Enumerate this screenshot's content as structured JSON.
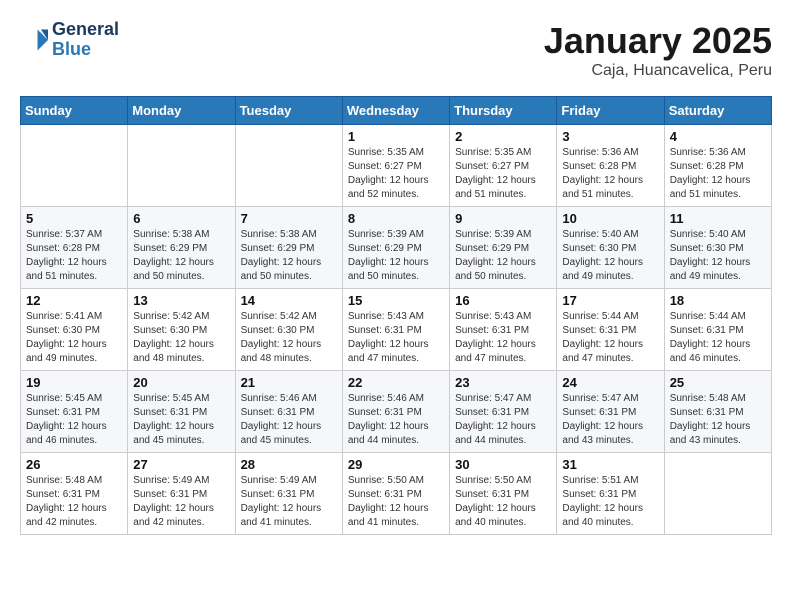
{
  "header": {
    "logo_line1": "General",
    "logo_line2": "Blue",
    "title": "January 2025",
    "subtitle": "Caja, Huancavelica, Peru"
  },
  "weekdays": [
    "Sunday",
    "Monday",
    "Tuesday",
    "Wednesday",
    "Thursday",
    "Friday",
    "Saturday"
  ],
  "weeks": [
    [
      {
        "day": "",
        "info": ""
      },
      {
        "day": "",
        "info": ""
      },
      {
        "day": "",
        "info": ""
      },
      {
        "day": "1",
        "info": "Sunrise: 5:35 AM\nSunset: 6:27 PM\nDaylight: 12 hours\nand 52 minutes."
      },
      {
        "day": "2",
        "info": "Sunrise: 5:35 AM\nSunset: 6:27 PM\nDaylight: 12 hours\nand 51 minutes."
      },
      {
        "day": "3",
        "info": "Sunrise: 5:36 AM\nSunset: 6:28 PM\nDaylight: 12 hours\nand 51 minutes."
      },
      {
        "day": "4",
        "info": "Sunrise: 5:36 AM\nSunset: 6:28 PM\nDaylight: 12 hours\nand 51 minutes."
      }
    ],
    [
      {
        "day": "5",
        "info": "Sunrise: 5:37 AM\nSunset: 6:28 PM\nDaylight: 12 hours\nand 51 minutes."
      },
      {
        "day": "6",
        "info": "Sunrise: 5:38 AM\nSunset: 6:29 PM\nDaylight: 12 hours\nand 50 minutes."
      },
      {
        "day": "7",
        "info": "Sunrise: 5:38 AM\nSunset: 6:29 PM\nDaylight: 12 hours\nand 50 minutes."
      },
      {
        "day": "8",
        "info": "Sunrise: 5:39 AM\nSunset: 6:29 PM\nDaylight: 12 hours\nand 50 minutes."
      },
      {
        "day": "9",
        "info": "Sunrise: 5:39 AM\nSunset: 6:29 PM\nDaylight: 12 hours\nand 50 minutes."
      },
      {
        "day": "10",
        "info": "Sunrise: 5:40 AM\nSunset: 6:30 PM\nDaylight: 12 hours\nand 49 minutes."
      },
      {
        "day": "11",
        "info": "Sunrise: 5:40 AM\nSunset: 6:30 PM\nDaylight: 12 hours\nand 49 minutes."
      }
    ],
    [
      {
        "day": "12",
        "info": "Sunrise: 5:41 AM\nSunset: 6:30 PM\nDaylight: 12 hours\nand 49 minutes."
      },
      {
        "day": "13",
        "info": "Sunrise: 5:42 AM\nSunset: 6:30 PM\nDaylight: 12 hours\nand 48 minutes."
      },
      {
        "day": "14",
        "info": "Sunrise: 5:42 AM\nSunset: 6:30 PM\nDaylight: 12 hours\nand 48 minutes."
      },
      {
        "day": "15",
        "info": "Sunrise: 5:43 AM\nSunset: 6:31 PM\nDaylight: 12 hours\nand 47 minutes."
      },
      {
        "day": "16",
        "info": "Sunrise: 5:43 AM\nSunset: 6:31 PM\nDaylight: 12 hours\nand 47 minutes."
      },
      {
        "day": "17",
        "info": "Sunrise: 5:44 AM\nSunset: 6:31 PM\nDaylight: 12 hours\nand 47 minutes."
      },
      {
        "day": "18",
        "info": "Sunrise: 5:44 AM\nSunset: 6:31 PM\nDaylight: 12 hours\nand 46 minutes."
      }
    ],
    [
      {
        "day": "19",
        "info": "Sunrise: 5:45 AM\nSunset: 6:31 PM\nDaylight: 12 hours\nand 46 minutes."
      },
      {
        "day": "20",
        "info": "Sunrise: 5:45 AM\nSunset: 6:31 PM\nDaylight: 12 hours\nand 45 minutes."
      },
      {
        "day": "21",
        "info": "Sunrise: 5:46 AM\nSunset: 6:31 PM\nDaylight: 12 hours\nand 45 minutes."
      },
      {
        "day": "22",
        "info": "Sunrise: 5:46 AM\nSunset: 6:31 PM\nDaylight: 12 hours\nand 44 minutes."
      },
      {
        "day": "23",
        "info": "Sunrise: 5:47 AM\nSunset: 6:31 PM\nDaylight: 12 hours\nand 44 minutes."
      },
      {
        "day": "24",
        "info": "Sunrise: 5:47 AM\nSunset: 6:31 PM\nDaylight: 12 hours\nand 43 minutes."
      },
      {
        "day": "25",
        "info": "Sunrise: 5:48 AM\nSunset: 6:31 PM\nDaylight: 12 hours\nand 43 minutes."
      }
    ],
    [
      {
        "day": "26",
        "info": "Sunrise: 5:48 AM\nSunset: 6:31 PM\nDaylight: 12 hours\nand 42 minutes."
      },
      {
        "day": "27",
        "info": "Sunrise: 5:49 AM\nSunset: 6:31 PM\nDaylight: 12 hours\nand 42 minutes."
      },
      {
        "day": "28",
        "info": "Sunrise: 5:49 AM\nSunset: 6:31 PM\nDaylight: 12 hours\nand 41 minutes."
      },
      {
        "day": "29",
        "info": "Sunrise: 5:50 AM\nSunset: 6:31 PM\nDaylight: 12 hours\nand 41 minutes."
      },
      {
        "day": "30",
        "info": "Sunrise: 5:50 AM\nSunset: 6:31 PM\nDaylight: 12 hours\nand 40 minutes."
      },
      {
        "day": "31",
        "info": "Sunrise: 5:51 AM\nSunset: 6:31 PM\nDaylight: 12 hours\nand 40 minutes."
      },
      {
        "day": "",
        "info": ""
      }
    ]
  ]
}
